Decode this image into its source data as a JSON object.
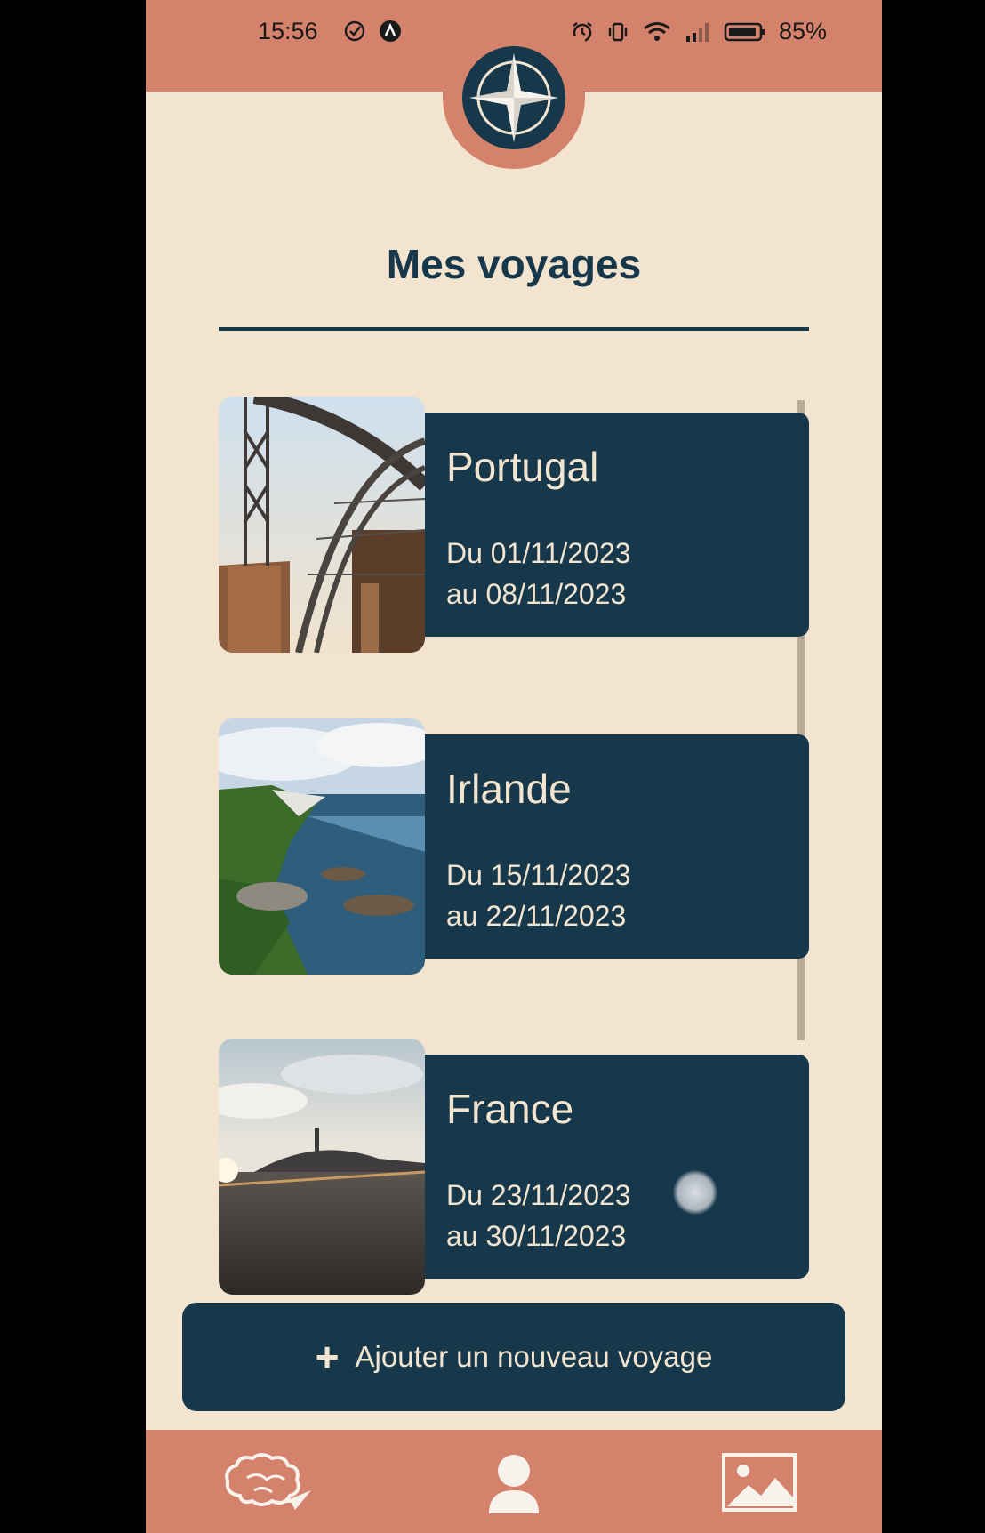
{
  "status_bar": {
    "time": "15:56",
    "battery": "85%",
    "icons": [
      "check-circle-icon",
      "a-app-icon",
      "alarm-icon",
      "vibrate-icon",
      "wifi-icon",
      "signal-icon",
      "battery-icon"
    ]
  },
  "header": {
    "logo_icon": "compass-rose-icon",
    "title": "Mes voyages"
  },
  "trips": [
    {
      "name": "Portugal",
      "from": "Du 01/11/2023",
      "to": "au 08/11/2023",
      "photo": "bridge-photo"
    },
    {
      "name": "Irlande",
      "from": "Du 15/11/2023",
      "to": "au 22/11/2023",
      "photo": "coast-photo"
    },
    {
      "name": "France",
      "from": "Du 23/11/2023",
      "to": "au 30/11/2023",
      "photo": "beach-photo"
    }
  ],
  "add_button": {
    "icon": "plus-icon",
    "label": "Ajouter un nouveau voyage"
  },
  "bottom_nav": [
    "brain-plane-icon",
    "user-icon",
    "image-icon"
  ],
  "colors": {
    "accent": "#d4826b",
    "navy": "#17384b",
    "cream": "#f2e4cf"
  }
}
